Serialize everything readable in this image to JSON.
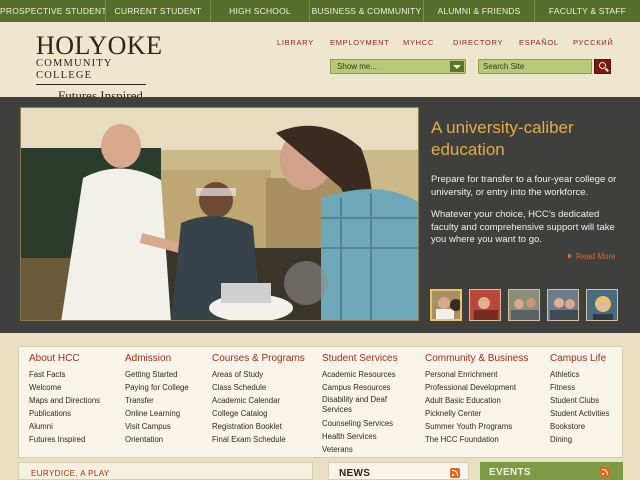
{
  "topnav": [
    {
      "label": "PROSPECTIVE STUDENT"
    },
    {
      "label": "CURRENT STUDENT"
    },
    {
      "label": "HIGH SCHOOL"
    },
    {
      "label": "BUSINESS & COMMUNITY"
    },
    {
      "label": "ALUMNI & FRIENDS"
    },
    {
      "label": "FACULTY & STAFF"
    }
  ],
  "logo": {
    "line1": "HOLYOKE",
    "line2": "COMMUNITY COLLEGE",
    "tagline": "Futures Inspired"
  },
  "utility": [
    {
      "label": "LIBRARY"
    },
    {
      "label": "EMPLOYMENT"
    },
    {
      "label": "MYHCC"
    },
    {
      "label": "DIRECTORY"
    },
    {
      "label": "ESPAÑOL"
    },
    {
      "label": "РУССКИЙ"
    }
  ],
  "showme": {
    "label": "Show me..."
  },
  "search": {
    "placeholder": "Search Site"
  },
  "hero": {
    "title": "A university-caliber education",
    "paragraph1": "Prepare for transfer to a four-year college or university, or entry into the workforce.",
    "paragraph2": "Whatever your choice, HCC’s dedicated faculty and comprehensive support will take you where you want to go.",
    "readmore": "Read More"
  },
  "directory": [
    {
      "heading": "About HCC",
      "links": [
        "Fast Facts",
        "Welcome",
        "Maps and Directions",
        "Publications",
        "Alumni",
        "Futures Inspired"
      ]
    },
    {
      "heading": "Admission",
      "links": [
        "Getting Started",
        "Paying for College",
        "Transfer",
        "Online Learning",
        "Visit Campus",
        "Orientation"
      ]
    },
    {
      "heading": "Courses & Programs",
      "links": [
        "Areas of Study",
        "Class Schedule",
        "Academic Calendar",
        "College Catalog",
        "Registration Booklet",
        "Final Exam Schedule"
      ]
    },
    {
      "heading": "Student Services",
      "links": [
        "Academic Resources",
        "Campus Resources",
        "Disability and Deaf Services",
        "Counseling Services",
        "Health Services",
        "Veterans"
      ]
    },
    {
      "heading": "Community & Business",
      "links": [
        "Personal Enrichment",
        "Professional Development",
        "Adult Basic Education",
        "Picknelly Center",
        "Summer Youth Programs",
        "The HCC Foundation"
      ]
    },
    {
      "heading": "Campus Life",
      "links": [
        "Athletics",
        "Fitness",
        "Student Clubs",
        "Student Activities",
        "Bookstore",
        "Dining"
      ]
    }
  ],
  "panels": {
    "feature": "EURYDICE, A PLAY",
    "news": "NEWS",
    "events": "EVENTS"
  },
  "colors": {
    "topnav_bg": "#566e2b",
    "accent_red": "#a02f1c",
    "hero_bg": "#3f3f3d",
    "hero_title": "#e3ae4a",
    "events_bg": "#7e9a45"
  }
}
